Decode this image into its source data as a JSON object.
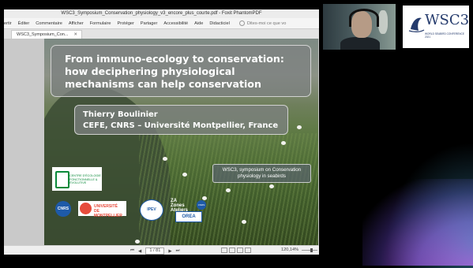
{
  "window": {
    "title": "WSC3_Symposium_Conservation_physiology_v3_encore_plus_courte.pdf - Foxit PhantomPDF"
  },
  "menu": {
    "items": [
      "ertir",
      "Éditer",
      "Commentaire",
      "Afficher",
      "Formulaire",
      "Protéger",
      "Partager",
      "Accessibilité",
      "Aide",
      "Didacticiel"
    ],
    "search_placeholder": "Dites-moi ce que vo"
  },
  "tabs": [
    {
      "label": "WSC3_Symposium_Con..."
    }
  ],
  "slide": {
    "title": "From immuno-ecology to conservation: how deciphering physiological mechanisms can help conservation",
    "author_name": "Thierry Boulinier",
    "author_affiliation": "CEFE, CNRS – Université Montpellier, France",
    "symposium_line1": "WSC3, symposium on Conservation",
    "symposium_line2": "physiology in seabirds",
    "logos": {
      "cefe_text": "CENTRE D'ÉCOLOGIE FONCTIONNELLE & ÉVOLUTIVE",
      "cnrs": "CNRS",
      "um_line1": "UNIVERSITÉ",
      "um_line2": "DE MONTPELLIER",
      "ipev": "IPEV",
      "za": "ZA Zones Ateliers",
      "ore": "OREA"
    }
  },
  "statusbar": {
    "page": "1 / 81",
    "zoom": "120,14%"
  },
  "wsc_logo": {
    "text": "WSC3",
    "subtitle": "WORLD SEABIRD CONFERENCE 2021"
  },
  "colors": {
    "menu_bg": "#f5f5f5",
    "slide_box": "#7d8282",
    "brand_blue": "#243a6c",
    "cefe_green": "#0a8a3a",
    "um_red": "#e74c3c"
  }
}
